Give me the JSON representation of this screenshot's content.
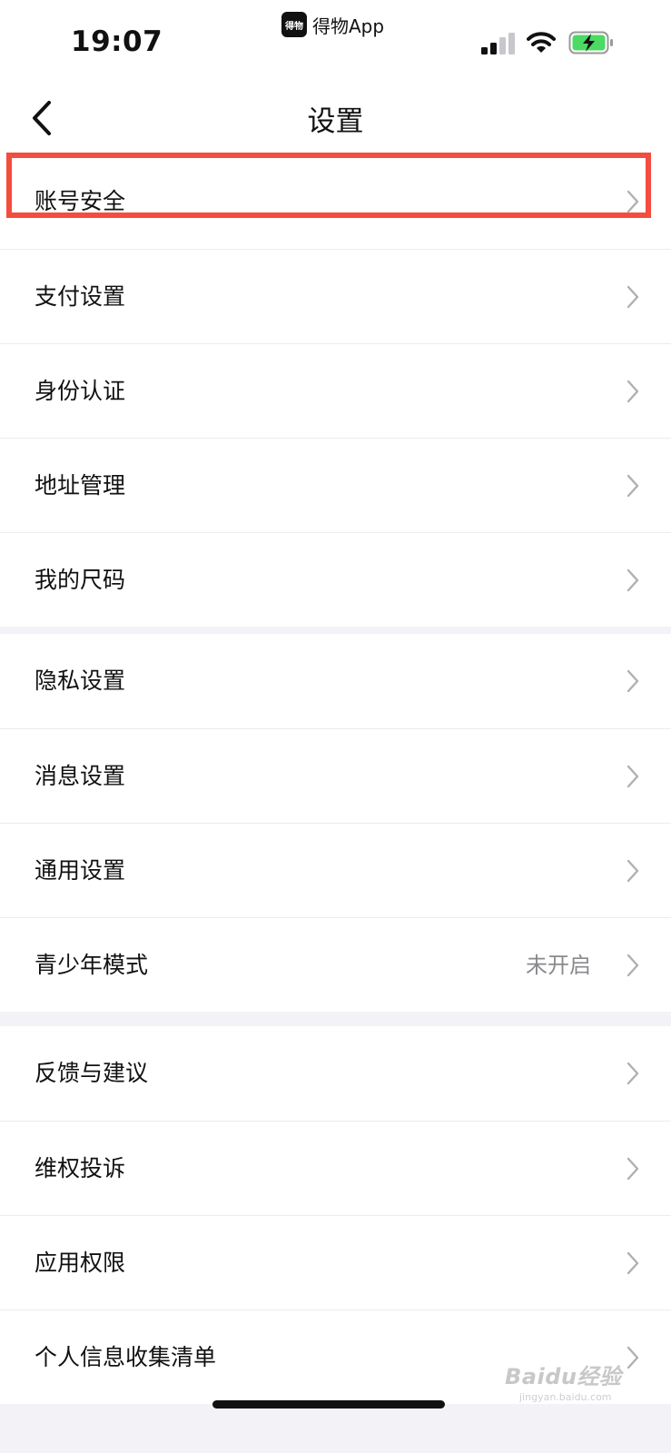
{
  "status_bar": {
    "time": "19:07",
    "app_icon_text": "得物",
    "app_name": "得物App"
  },
  "nav": {
    "title": "设置"
  },
  "groups": [
    {
      "items": [
        {
          "label": "账号安全",
          "highlighted": true
        },
        {
          "label": "支付设置"
        },
        {
          "label": "身份认证"
        },
        {
          "label": "地址管理"
        },
        {
          "label": "我的尺码"
        }
      ]
    },
    {
      "items": [
        {
          "label": "隐私设置"
        },
        {
          "label": "消息设置"
        },
        {
          "label": "通用设置"
        },
        {
          "label": "青少年模式",
          "value": "未开启"
        }
      ]
    },
    {
      "items": [
        {
          "label": "反馈与建议"
        },
        {
          "label": "维权投诉"
        },
        {
          "label": "应用权限"
        },
        {
          "label": "个人信息收集清单"
        }
      ]
    }
  ],
  "watermark": {
    "text": "Baidu经验",
    "sub": "jingyan.baidu.com"
  },
  "colors": {
    "highlight": "#f44c3e",
    "battery_fill": "#4cd964",
    "separator_bg": "#f3f3f7"
  }
}
